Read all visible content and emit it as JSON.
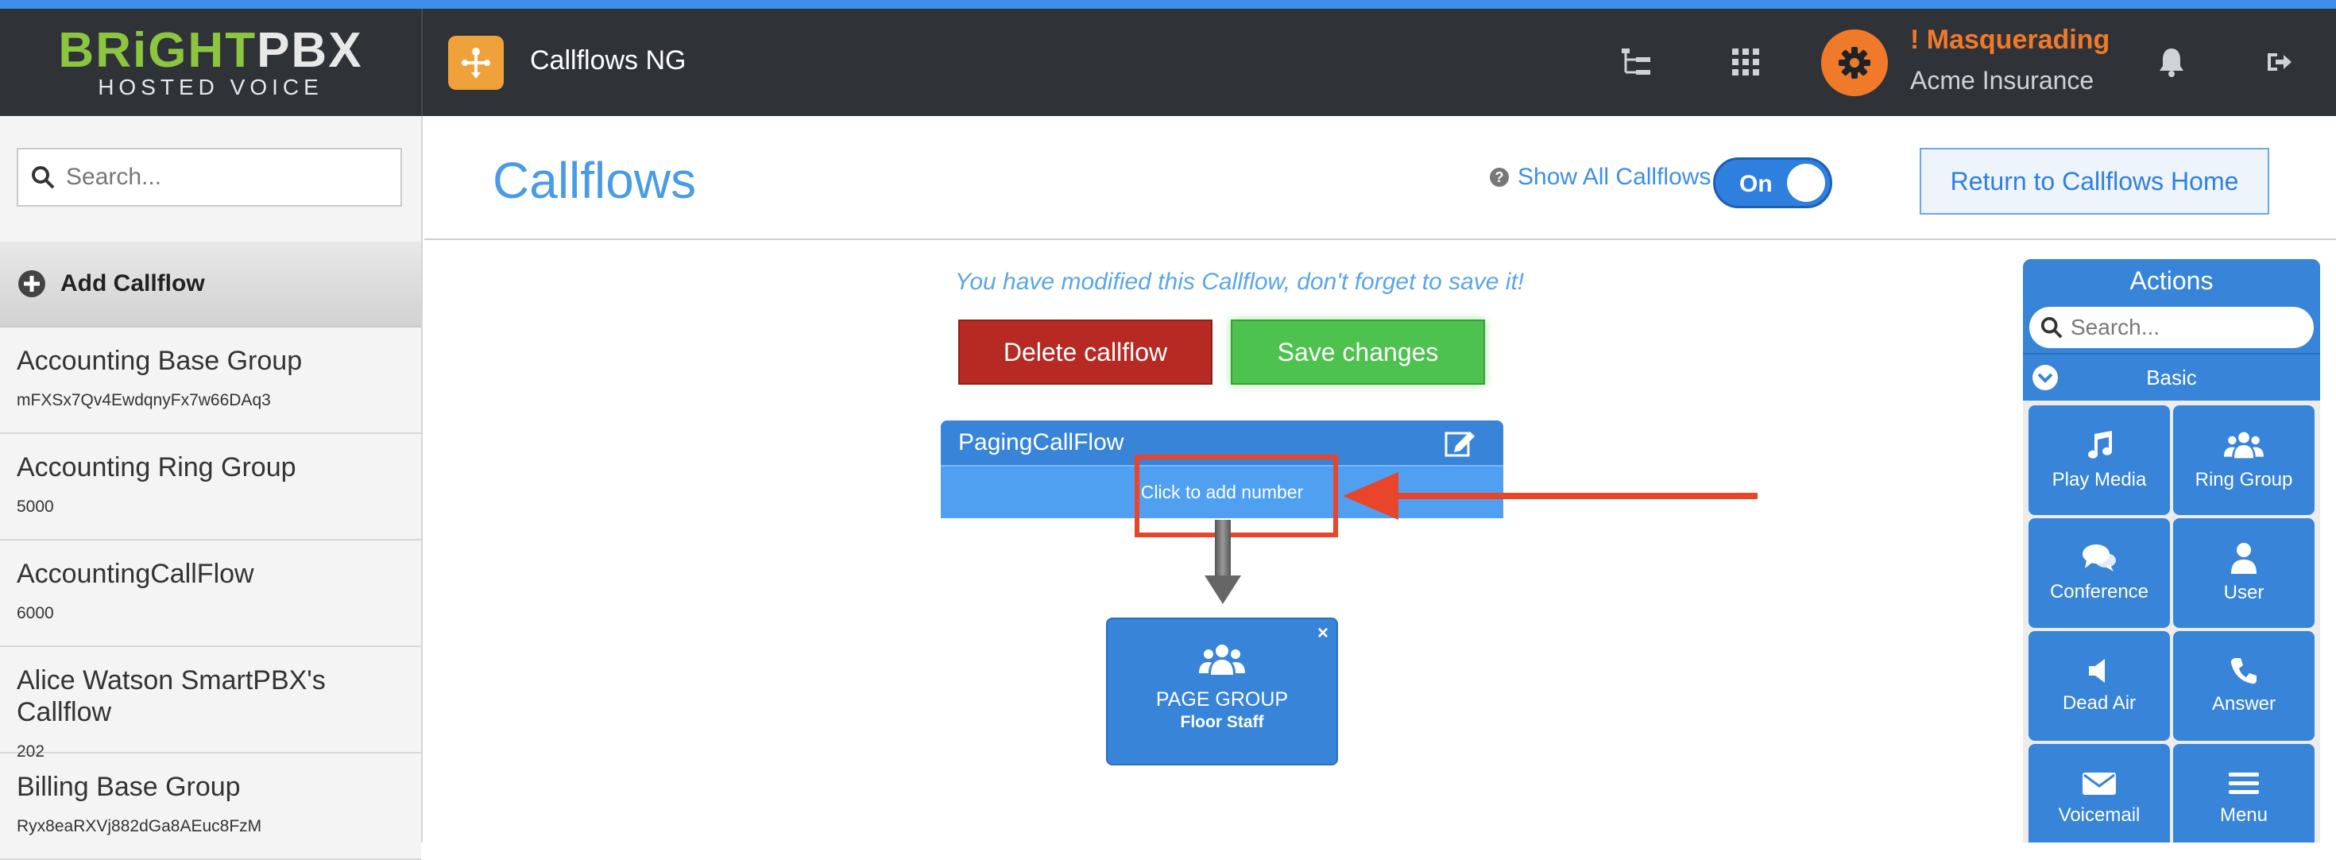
{
  "brand": {
    "word_part1": "BRiGHT",
    "word_part2": "PBX",
    "subtitle": "HOSTED VOICE"
  },
  "topbar": {
    "app_title": "Callflows NG",
    "masquerading": "! Masquerading",
    "account": "Acme Insurance"
  },
  "sidebar": {
    "search_placeholder": "Search...",
    "add_label": "Add Callflow",
    "items": [
      {
        "name": "Accounting Base Group",
        "number": "mFXSx7Qv4EwdqnyFx7w66DAq3"
      },
      {
        "name": "Accounting Ring Group",
        "number": "5000"
      },
      {
        "name": "AccountingCallFlow",
        "number": "6000"
      },
      {
        "name": "Alice Watson SmartPBX's Callflow",
        "number": "202"
      },
      {
        "name": "Billing Base Group",
        "number": "Ryx8eaRXVj882dGa8AEuc8FzM"
      }
    ]
  },
  "header": {
    "title": "Callflows",
    "show_all_label": "Show All Callflows",
    "toggle_label": "On",
    "return_label": "Return to Callflows Home"
  },
  "editor": {
    "modified_notice": "You have modified this Callflow, don't forget to save it!",
    "delete_label": "Delete callflow",
    "save_label": "Save changes",
    "flow_name": "PagingCallFlow",
    "add_number_label": "Click to add number",
    "node": {
      "title": "PAGE GROUP",
      "subtitle": "Floor Staff",
      "close": "×"
    }
  },
  "actions": {
    "title": "Actions",
    "search_placeholder": "Search...",
    "category": "Basic",
    "tiles": [
      {
        "label": "Play Media",
        "icon": "music-icon"
      },
      {
        "label": "Ring Group",
        "icon": "users-icon"
      },
      {
        "label": "Conference",
        "icon": "comments-icon"
      },
      {
        "label": "User",
        "icon": "user-icon"
      },
      {
        "label": "Dead Air",
        "icon": "speaker-icon"
      },
      {
        "label": "Answer",
        "icon": "phone-icon"
      },
      {
        "label": "Voicemail",
        "icon": "envelope-icon"
      },
      {
        "label": "Menu",
        "icon": "menu-icon"
      }
    ]
  },
  "colors": {
    "accent": "#3784d8",
    "warning": "#f07a2a",
    "danger": "#b72a24",
    "success": "#4ec24e",
    "annotation": "#e8452a"
  }
}
